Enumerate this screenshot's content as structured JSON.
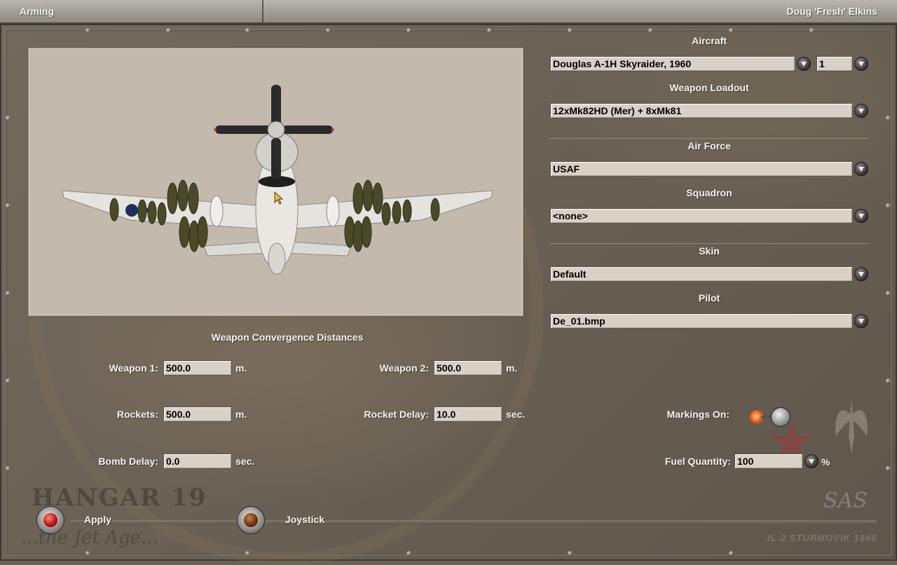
{
  "titlebar": {
    "left_title": "Arming",
    "right_title": "Doug 'Fresh' Elkins"
  },
  "aircraft": {
    "label": "Aircraft",
    "value": "Douglas A-1H Skyraider, 1960",
    "number": "1"
  },
  "weapon_loadout": {
    "label": "Weapon Loadout",
    "value": "12xMk82HD (Mer) + 8xMk81"
  },
  "air_force": {
    "label": "Air Force",
    "value": "USAF"
  },
  "squadron": {
    "label": "Squadron",
    "value": "<none>"
  },
  "skin": {
    "label": "Skin",
    "value": "Default"
  },
  "pilot": {
    "label": "Pilot",
    "value": "De_01.bmp"
  },
  "convergence": {
    "heading": "Weapon Convergence Distances",
    "weapon1": {
      "label": "Weapon 1:",
      "value": "500.0",
      "unit": "m."
    },
    "weapon2": {
      "label": "Weapon 2:",
      "value": "500.0",
      "unit": "m."
    },
    "rockets": {
      "label": "Rockets:",
      "value": "500.0",
      "unit": "m."
    },
    "rocket_delay": {
      "label": "Rocket Delay:",
      "value": "10.0",
      "unit": "sec."
    },
    "bomb_delay": {
      "label": "Bomb Delay:",
      "value": "0.0",
      "unit": "sec."
    }
  },
  "markings": {
    "label": "Markings On:",
    "state": "on"
  },
  "fuel": {
    "label": "Fuel Quantity:",
    "value": "100",
    "unit": "%"
  },
  "buttons": {
    "apply_label": "Apply",
    "joystick_label": "Joystick"
  },
  "watermarks": {
    "hangar": "HANGAR 19",
    "jet_age": "...the Jet Age...",
    "sas": "SAS",
    "il2": "IL-2 STURMOVIK 1946"
  },
  "icons": {
    "dropdown": "chevron-down-icon",
    "apply_jewel": "red-light-icon",
    "joystick_jewel": "amber-light-icon"
  },
  "colors": {
    "field_bg": "#d9d1c5",
    "panel_bg": "#6b6257",
    "viewport_bg": "#c3b9ac",
    "lamp_on": "#ff5a1a"
  }
}
